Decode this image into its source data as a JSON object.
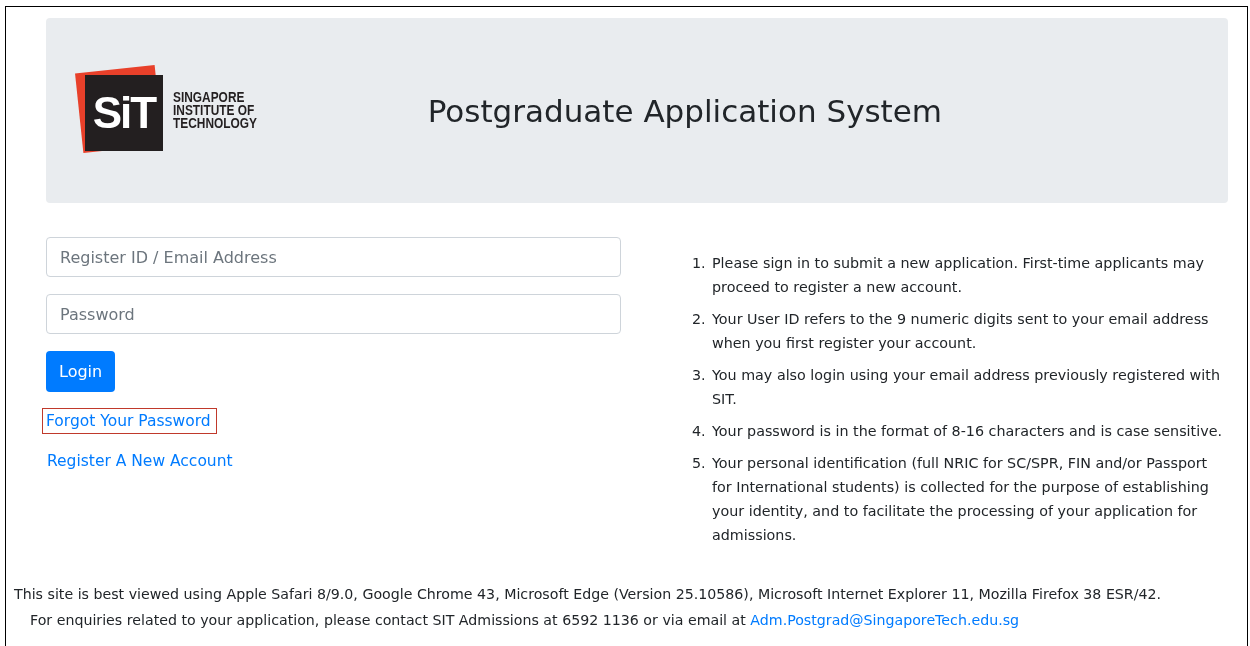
{
  "header": {
    "logo": {
      "mark": "SiT",
      "lines": [
        "SINGAPORE",
        "INSTITUTE OF",
        "TECHNOLOGY"
      ]
    },
    "title": "Postgraduate Application System"
  },
  "login_form": {
    "fields": [
      {
        "placeholder": "Register ID / Email Address"
      },
      {
        "placeholder": "Password"
      }
    ],
    "button": "Login",
    "links": [
      {
        "label": "Forgot Your Password",
        "highlighted": true
      },
      {
        "label": "Register A New Account",
        "highlighted": false
      }
    ]
  },
  "notes": [
    {
      "marker": "1.",
      "text": "Please sign in to submit a new application. First-time applicants may proceed to register a new account."
    },
    {
      "marker": "2.",
      "text": "Your User ID refers to the 9 numeric digits sent to your email address when you first register your account."
    },
    {
      "marker": "3.",
      "text": "You may also login using your email address previously registered with SIT."
    },
    {
      "marker": "4.",
      "text": "Your password is in the format of 8-16 characters and is case sensitive."
    },
    {
      "marker": "5.",
      "text": "Your personal identification (full NRIC for SC/SPR, FIN and/or Passport for International students) is collected for the purpose of establishing your identity, and to facilitate the processing of your application for admissions."
    }
  ],
  "footer": {
    "browser_note": "This site is best viewed using Apple Safari 8/9.0, Google Chrome 43, Microsoft Edge (Version 25.10586), Microsoft Internet Explorer 11, Mozilla Firefox 38 ESR/42.",
    "contact": "For enquiries related to your application, please contact SIT Admissions at 6592 1136 or via email at ",
    "email": "Adm.Postgrad@SingaporeTech.edu.sg"
  }
}
